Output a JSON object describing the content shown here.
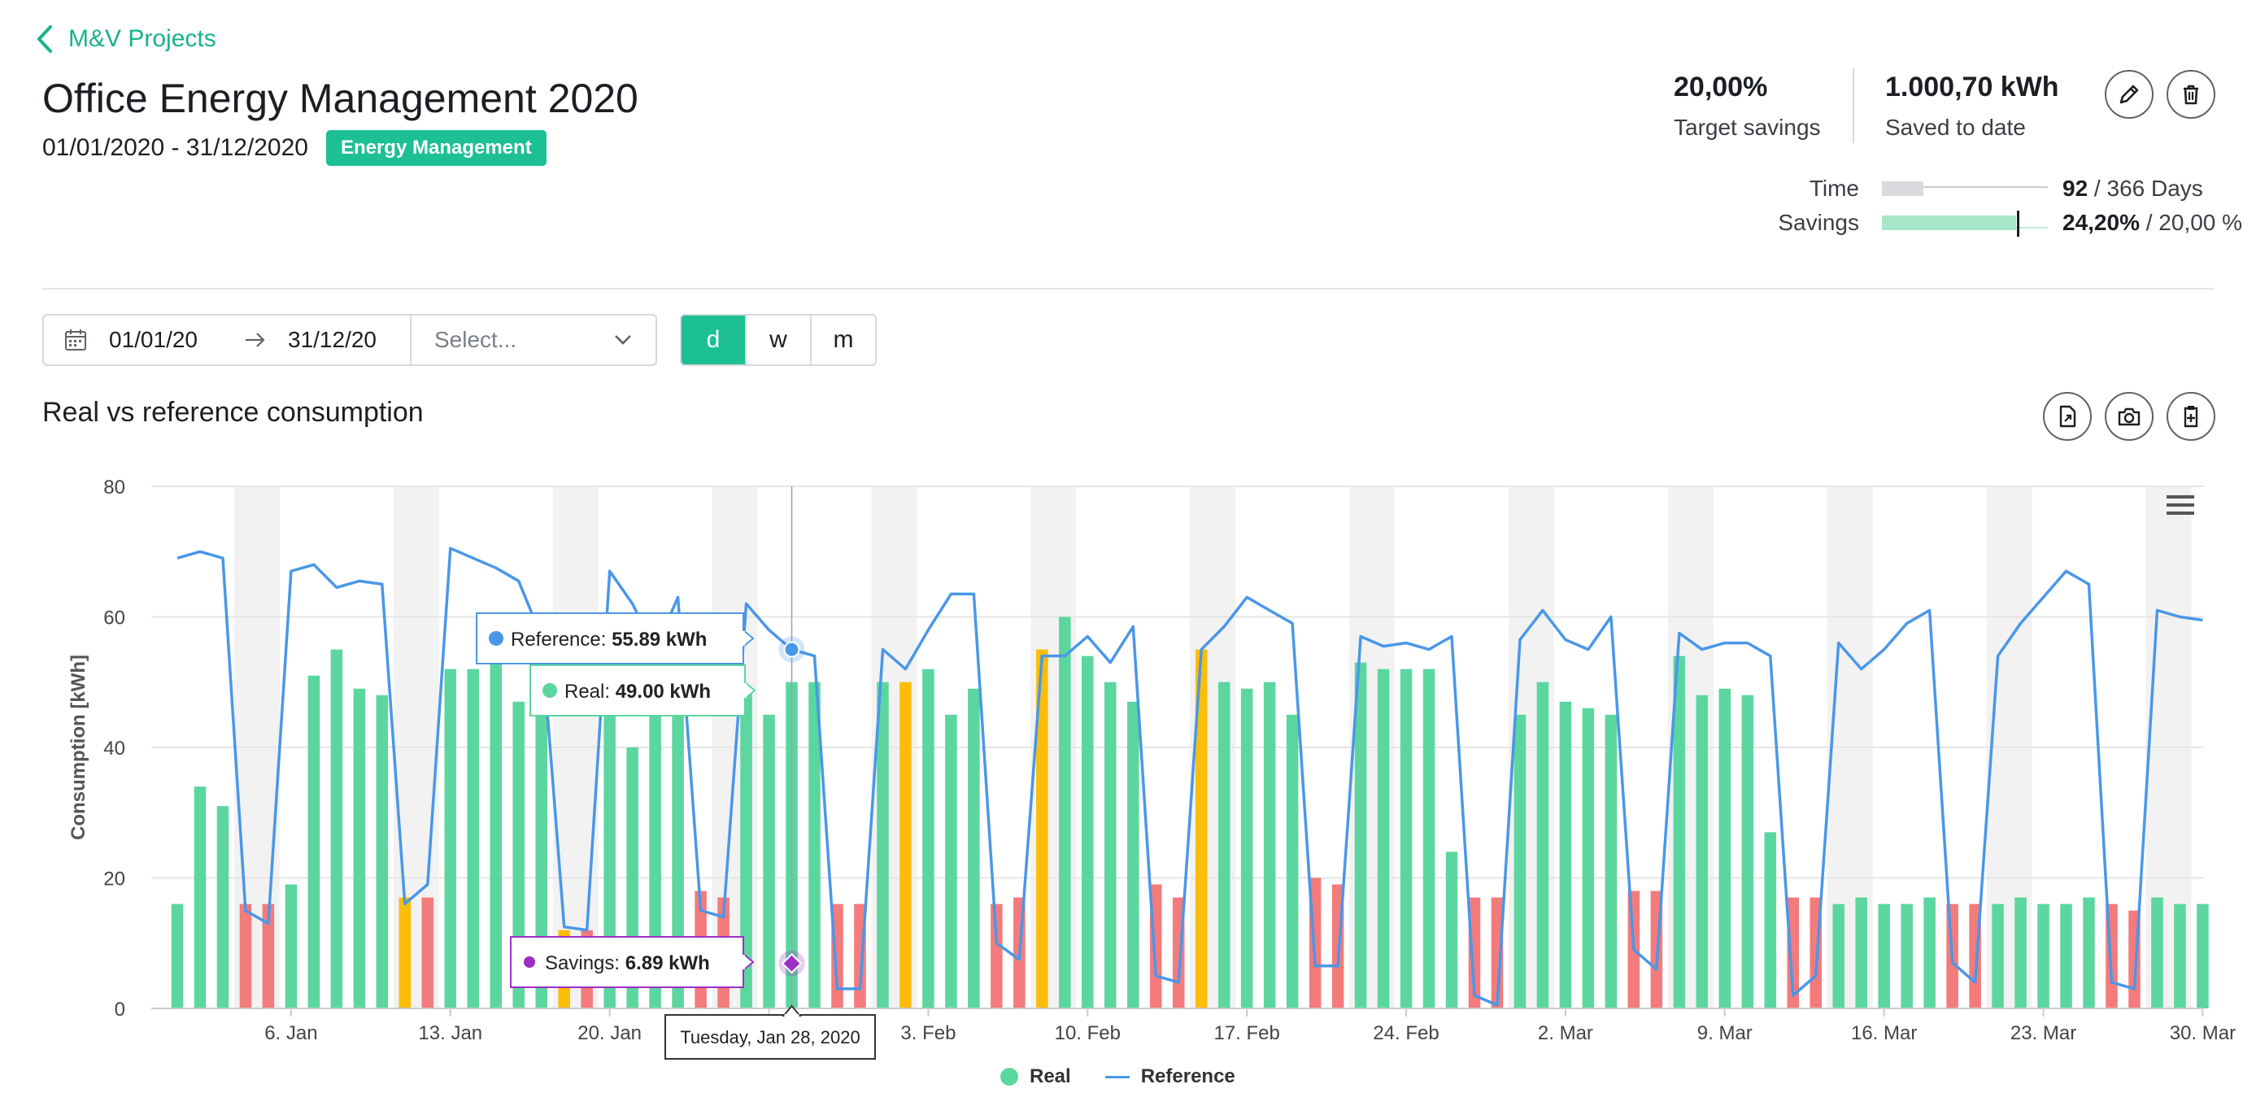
{
  "nav": {
    "back_label": "M&V Projects"
  },
  "project": {
    "title": "Office Energy Management 2020",
    "date_range": "01/01/2020 - 31/12/2020",
    "category_badge": "Energy Management"
  },
  "kpis": [
    {
      "value": "20,00%",
      "label": "Target savings"
    },
    {
      "value": "1.000,70 kWh",
      "label": "Saved to date"
    }
  ],
  "actions": {
    "edit_icon": "pencil-icon",
    "delete_icon": "trash-icon"
  },
  "progress": {
    "time": {
      "label": "Time",
      "current": "92",
      "total": " / 366 Days",
      "fraction": 0.251
    },
    "savings": {
      "label": "Savings",
      "current": "24,20%",
      "target": " / 20,00 %",
      "value_percent": 24.2,
      "target_percent": 20.0
    }
  },
  "controls": {
    "date_from": "01/01/20",
    "date_to": "31/12/20",
    "select_placeholder": "Select...",
    "granularity": [
      "d",
      "w",
      "m"
    ],
    "granularity_active": "d"
  },
  "chart_section": {
    "title": "Real vs reference consumption",
    "export_icons": [
      "file-export-icon",
      "camera-icon",
      "clipboard-plus-icon"
    ]
  },
  "colors": {
    "real": "#5cd69f",
    "real_low": "#f47b7b",
    "real_yellow": "#fbbd08",
    "reference": "#4a97e8",
    "savings": "#9b30c4",
    "accent": "#1dbf95"
  },
  "chart_data": {
    "type": "bar",
    "ylabel": "Consumption [kWh]",
    "ylim": [
      0,
      80
    ],
    "yticks": [
      0,
      20,
      40,
      60,
      80
    ],
    "x_start": "2020-01-01",
    "x_end": "2020-04-01",
    "xticks": [
      "6. Jan",
      "13. Jan",
      "20. Jan",
      "27. Jan",
      "3. Feb",
      "10. Feb",
      "17. Feb",
      "24. Feb",
      "2. Mar",
      "9. Mar",
      "16. Mar",
      "23. Mar",
      "30. Mar"
    ],
    "weekend_shading": true,
    "grid": true,
    "legend": {
      "position": "bottom",
      "entries": [
        "Real",
        "Reference"
      ]
    },
    "series": [
      {
        "name": "Real",
        "type": "bar",
        "values": [
          16,
          34,
          31,
          16,
          16,
          19,
          51,
          55,
          49,
          48,
          17,
          17,
          52,
          52,
          53,
          47,
          47,
          12,
          12,
          48,
          40,
          46,
          53,
          18,
          17,
          49,
          45,
          50,
          50,
          16,
          16,
          50,
          50,
          52,
          45,
          49,
          16,
          17,
          55,
          60,
          54,
          50,
          47,
          19,
          17,
          55,
          50,
          49,
          50,
          45,
          20,
          19,
          53,
          52,
          52,
          52,
          24,
          17,
          17,
          45,
          50,
          47,
          46,
          45,
          18,
          18,
          54,
          48,
          49,
          48,
          27,
          17,
          17,
          16,
          17,
          16,
          16,
          17,
          16,
          16,
          16,
          17,
          16,
          16,
          17,
          16,
          15,
          17,
          16,
          16
        ]
      },
      {
        "name": "Reference",
        "type": "line",
        "values": [
          69,
          70,
          69,
          15,
          13,
          67,
          68,
          64.5,
          65.5,
          65,
          16,
          19,
          70.5,
          69,
          67.5,
          65.5,
          57,
          12.5,
          12,
          67,
          62,
          55,
          63,
          15,
          14,
          62,
          58,
          55,
          54,
          3,
          3,
          55,
          52,
          58,
          63.5,
          63.5,
          10,
          7.5,
          54,
          54,
          57,
          53,
          58.5,
          5,
          4,
          55,
          58.5,
          63,
          61,
          59,
          6.5,
          6.5,
          57,
          55.5,
          56,
          55,
          57,
          2,
          0.5,
          56.5,
          61,
          56.5,
          55,
          60,
          9,
          6,
          57.5,
          55,
          56,
          56,
          54,
          2,
          5,
          56,
          52,
          55,
          59,
          61,
          7,
          4,
          54,
          59,
          63,
          67,
          65,
          4,
          3,
          61,
          60,
          59.5
        ]
      }
    ],
    "bar_color_categories": {
      "low_weekend_indices": [
        3,
        4,
        10,
        11,
        17,
        18,
        23,
        24,
        29,
        30,
        36,
        37,
        43,
        44,
        50,
        51,
        57,
        58,
        64,
        65,
        71,
        72,
        78,
        79,
        85,
        86
      ],
      "yellow_indices": [
        10,
        17,
        32,
        38,
        45
      ]
    },
    "tooltip": {
      "date": "Tuesday, Jan 28, 2020",
      "reference_label": "Reference: ",
      "reference_value": "55.89 kWh",
      "real_label": "Real: ",
      "real_value": "49.00 kWh",
      "savings_label": "Savings: ",
      "savings_value": "6.89 kWh",
      "savings_y": 6.89
    },
    "menu_icon": "hamburger-menu-icon"
  }
}
